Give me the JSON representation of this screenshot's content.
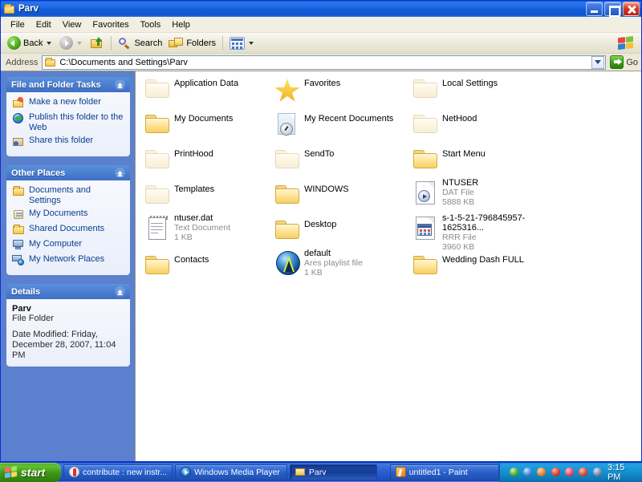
{
  "window": {
    "title": "Parv",
    "title_icon": "folder-icon",
    "controls": {
      "minimize": "minimize-button",
      "restore": "restore-button",
      "close": "close-button"
    }
  },
  "menubar": {
    "items": [
      "File",
      "Edit",
      "View",
      "Favorites",
      "Tools",
      "Help"
    ]
  },
  "toolbar": {
    "back_label": "Back",
    "search_label": "Search",
    "folders_label": "Folders",
    "icons": {
      "back": "back-arrow-icon",
      "forward": "forward-arrow-icon",
      "up": "up-folder-icon",
      "search": "magnifier-icon",
      "folders": "folders-icon",
      "views": "views-icon",
      "brand": "windows-flag-icon"
    }
  },
  "address": {
    "label": "Address",
    "path": "C:\\Documents and Settings\\Parv",
    "go_label": "Go",
    "folder_icon": "folder-icon",
    "dropdown_icon": "chevron-down-icon",
    "go_icon": "green-arrow-icon"
  },
  "sidebar": {
    "panels": [
      {
        "title": "File and Folder Tasks",
        "collapse_icon": "chevron-up-icon",
        "items": [
          {
            "label": "Make a new folder",
            "icon": "new-folder-icon"
          },
          {
            "label": "Publish this folder to the Web",
            "icon": "globe-icon"
          },
          {
            "label": "Share this folder",
            "icon": "share-folder-icon"
          }
        ]
      },
      {
        "title": "Other Places",
        "collapse_icon": "chevron-up-icon",
        "items": [
          {
            "label": "Documents and Settings",
            "icon": "folder-icon"
          },
          {
            "label": "My Documents",
            "icon": "my-documents-icon"
          },
          {
            "label": "Shared Documents",
            "icon": "folder-icon"
          },
          {
            "label": "My Computer",
            "icon": "computer-icon"
          },
          {
            "label": "My Network Places",
            "icon": "network-icon"
          }
        ]
      },
      {
        "title": "Details",
        "collapse_icon": "chevron-up-icon",
        "details": {
          "name": "Parv",
          "type": "File Folder",
          "date_modified_line1": "Date Modified: Friday,",
          "date_modified_line2": "December 28, 2007, 11:04 PM"
        }
      }
    ]
  },
  "files": [
    {
      "name": "Application Data",
      "icon": "folder-icon",
      "dim": true
    },
    {
      "name": "Favorites",
      "icon": "star-icon",
      "dim": false
    },
    {
      "name": "Local Settings",
      "icon": "folder-icon",
      "dim": true
    },
    {
      "name": "My Documents",
      "icon": "folder-icon",
      "dim": false
    },
    {
      "name": "My Recent Documents",
      "icon": "recent-documents-icon",
      "dim": true
    },
    {
      "name": "NetHood",
      "icon": "folder-icon",
      "dim": true
    },
    {
      "name": "PrintHood",
      "icon": "folder-icon",
      "dim": true
    },
    {
      "name": "SendTo",
      "icon": "folder-icon",
      "dim": true
    },
    {
      "name": "Start Menu",
      "icon": "folder-icon",
      "dim": false
    },
    {
      "name": "Templates",
      "icon": "folder-icon",
      "dim": true
    },
    {
      "name": "WINDOWS",
      "icon": "folder-icon",
      "dim": false
    },
    {
      "name": "NTUSER",
      "type": "DAT File",
      "size": "5888 KB",
      "icon": "dat-file-icon",
      "dim": true
    },
    {
      "name": "ntuser.dat",
      "type": "Text Document",
      "size": "1 KB",
      "icon": "text-document-icon",
      "dim": true
    },
    {
      "name": "Desktop",
      "icon": "folder-icon",
      "dim": false
    },
    {
      "name": "s-1-5-21-796845957-1625316...",
      "type": "RRR File",
      "size": "3960 KB",
      "icon": "rrr-file-icon",
      "dim": true
    },
    {
      "name": "Contacts",
      "icon": "folder-icon",
      "dim": false
    },
    {
      "name": "default",
      "type": "Ares playlist file",
      "size": "1 KB",
      "icon": "ares-playlist-icon",
      "dim": false
    },
    {
      "name": "Wedding Dash FULL",
      "icon": "folder-icon",
      "dim": false
    }
  ],
  "taskbar": {
    "start_label": "start",
    "start_icon": "windows-flag-icon",
    "buttons": [
      {
        "label": "contribute : new instr...",
        "icon": "contribute-icon",
        "active": false
      },
      {
        "label": "Windows Media Player",
        "icon": "media-player-icon",
        "active": false
      },
      {
        "label": "Parv",
        "icon": "folder-icon",
        "active": true
      },
      {
        "label": "untitled1 - Paint",
        "icon": "paint-icon",
        "active": false
      }
    ],
    "tray_icons": [
      "tray-icon-1",
      "tray-icon-2",
      "tray-icon-3",
      "tray-icon-4",
      "tray-icon-5",
      "tray-icon-6",
      "tray-icon-7"
    ],
    "clock": "3:15 PM"
  },
  "colors": {
    "titlebar_blue": "#0f55d0",
    "sidebar_blue": "#5a80ce",
    "panel_header": "#4a7fd2",
    "link_blue": "#0b3e8f",
    "start_green": "#3f9416",
    "desktop_blue": "#5a7edc"
  }
}
